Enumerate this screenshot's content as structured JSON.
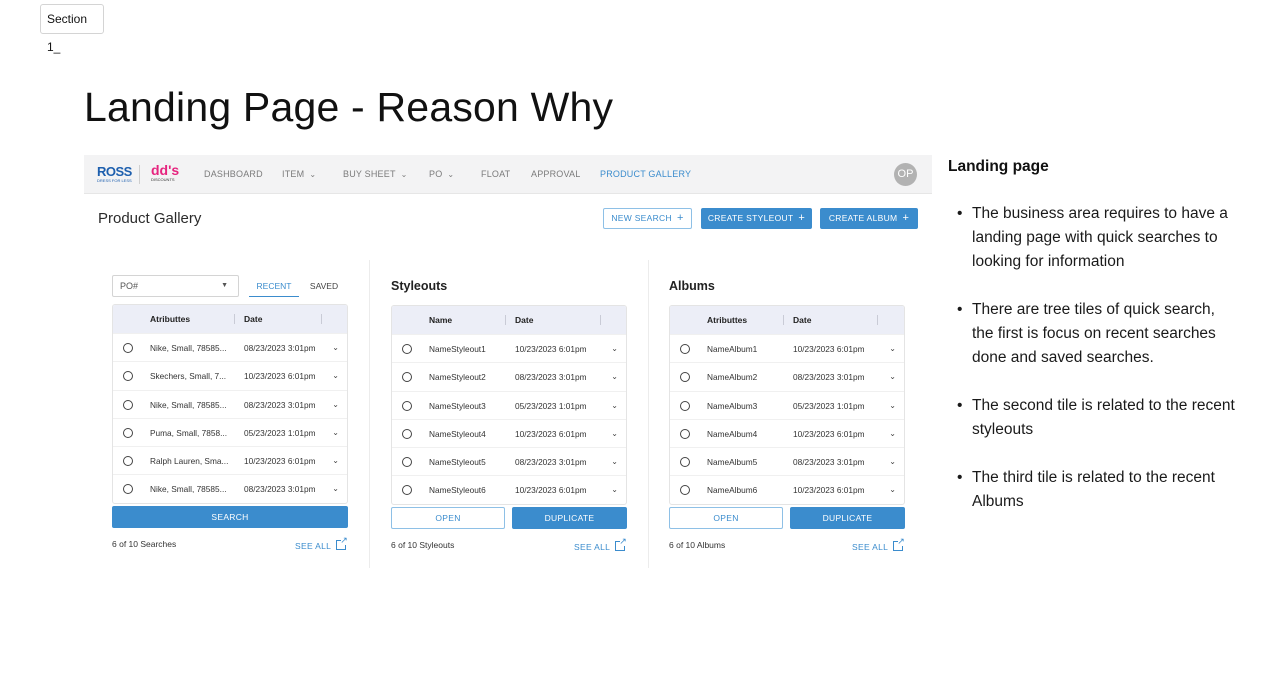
{
  "section_tag": "Section 1_",
  "page_title": "Landing Page - Reason Why",
  "nav": {
    "logo_ross": "ROSS",
    "logo_ross_tagline": "DRESS FOR LESS",
    "logo_dds": "dd's",
    "logo_dds_tagline": "DISCOUNTS",
    "items": [
      "DASHBOARD",
      "ITEM",
      "BUY SHEET",
      "PO",
      "FLOAT",
      "APPROVAL",
      "PRODUCT GALLERY"
    ],
    "avatar": "OP"
  },
  "gallery": {
    "title": "Product Gallery",
    "new_search": "NEW SEARCH",
    "create_styleout": "CREATE STYLEOUT",
    "create_album": "CREATE ALBUM"
  },
  "searches": {
    "select_value": "PO#",
    "tab_recent": "RECENT",
    "tab_saved": "SAVED",
    "col_a": "Atributtes",
    "col_b": "Date",
    "rows": [
      {
        "a": "Nike, Small, 78585...",
        "b": "08/23/2023 3:01pm"
      },
      {
        "a": "Skechers, Small, 7...",
        "b": "10/23/2023 6:01pm"
      },
      {
        "a": "Nike, Small, 78585...",
        "b": "08/23/2023 3:01pm"
      },
      {
        "a": "Puma, Small, 7858...",
        "b": "05/23/2023 1:01pm"
      },
      {
        "a": "Ralph Lauren, Sma...",
        "b": "10/23/2023 6:01pm"
      },
      {
        "a": "Nike, Small, 78585...",
        "b": "08/23/2023 3:01pm"
      }
    ],
    "search_button": "SEARCH",
    "count": "6 of 10 Searches",
    "see_all": "SEE ALL"
  },
  "styleouts": {
    "title": "Styleouts",
    "col_a": "Name",
    "col_b": "Date",
    "rows": [
      {
        "a": "NameStyleout1",
        "b": "10/23/2023 6:01pm"
      },
      {
        "a": "NameStyleout2",
        "b": "08/23/2023 3:01pm"
      },
      {
        "a": "NameStyleout3",
        "b": "05/23/2023 1:01pm"
      },
      {
        "a": "NameStyleout4",
        "b": "10/23/2023 6:01pm"
      },
      {
        "a": "NameStyleout5",
        "b": "08/23/2023 3:01pm"
      },
      {
        "a": "NameStyleout6",
        "b": "10/23/2023 6:01pm"
      }
    ],
    "open": "OPEN",
    "duplicate": "DUPLICATE",
    "count": "6 of 10 Styleouts",
    "see_all": "SEE ALL"
  },
  "albums": {
    "title": "Albums",
    "col_a": "Atributtes",
    "col_b": "Date",
    "rows": [
      {
        "a": "NameAlbum1",
        "b": "10/23/2023 6:01pm"
      },
      {
        "a": "NameAlbum2",
        "b": "08/23/2023 3:01pm"
      },
      {
        "a": "NameAlbum3",
        "b": "05/23/2023 1:01pm"
      },
      {
        "a": "NameAlbum4",
        "b": "10/23/2023 6:01pm"
      },
      {
        "a": "NameAlbum5",
        "b": "08/23/2023 3:01pm"
      },
      {
        "a": "NameAlbum6",
        "b": "10/23/2023 6:01pm"
      }
    ],
    "open": "OPEN",
    "duplicate": "DUPLICATE",
    "count": "6 of 10 Albums",
    "see_all": "SEE ALL"
  },
  "notes": {
    "title": "Landing page",
    "items": [
      "The business area requires to  have a landing page with quick  searches to looking for  information",
      "There are tree tiles of quick search, the first is focus on recent searches done and saved searches.",
      "The second tile is related to the recent styleouts",
      "The third tile is related to the recent Albums"
    ]
  },
  "colors": {
    "accent": "#3b8ccd",
    "header_bg": "#eceef7",
    "nav_bg": "#f3f3f4",
    "ross_blue": "#1d5fae",
    "dds_pink": "#e6247f"
  }
}
